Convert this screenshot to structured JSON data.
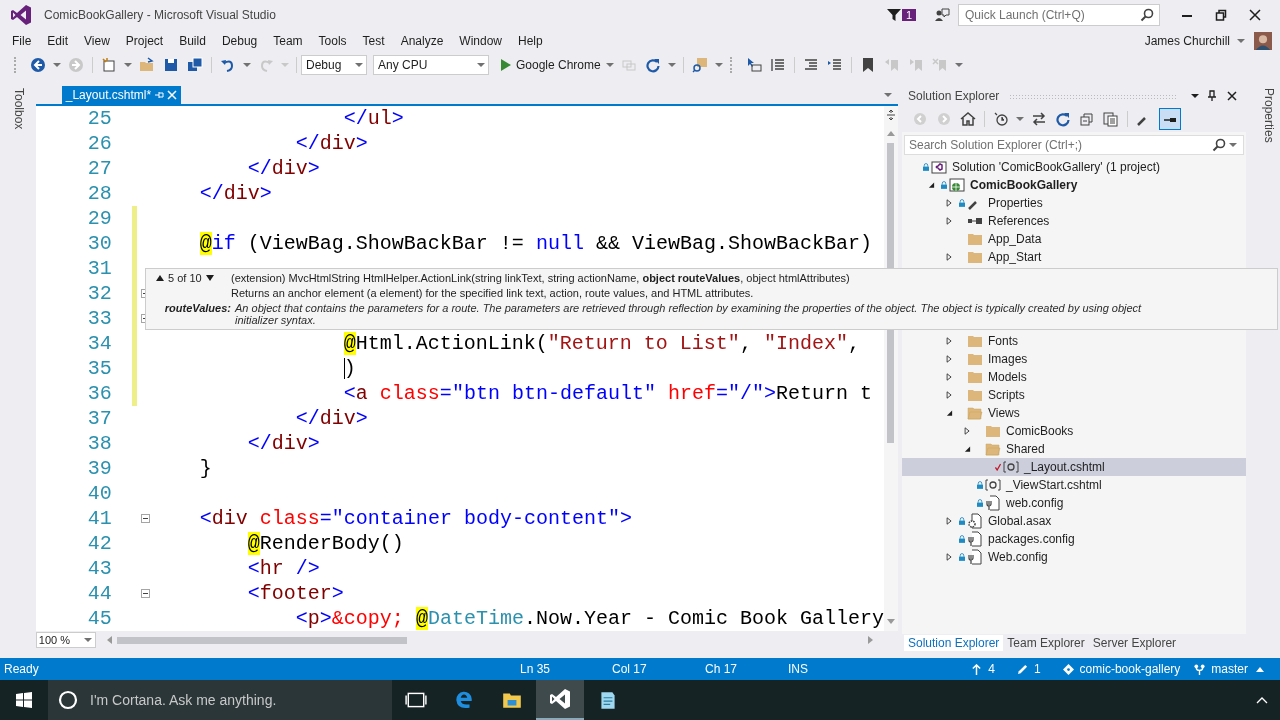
{
  "window": {
    "title": "ComicBookGallery - Microsoft Visual Studio",
    "notification_count": "1",
    "quick_launch": {
      "placeholder": "Quick Launch (Ctrl+Q)"
    }
  },
  "menu": [
    "File",
    "Edit",
    "View",
    "Project",
    "Build",
    "Debug",
    "Team",
    "Tools",
    "Test",
    "Analyze",
    "Window",
    "Help"
  ],
  "user": {
    "name": "James Churchill"
  },
  "toolbar": {
    "configuration": "Debug",
    "platform": "Any CPU",
    "start": "Google Chrome"
  },
  "side_tabs": {
    "left": "Toolbox",
    "right": "Properties"
  },
  "editor": {
    "tab": {
      "label": "_Layout.cshtml*",
      "selected": true
    },
    "zoom": "100 %",
    "lines": [
      {
        "num": "25",
        "tokens": [
          {
            "text": "                </",
            "kind": "delimiter"
          },
          {
            "text": "ul",
            "kind": "tag"
          },
          {
            "text": ">",
            "kind": "delimiter"
          }
        ]
      },
      {
        "num": "26",
        "tokens": [
          {
            "text": "            </",
            "kind": "delimiter"
          },
          {
            "text": "div",
            "kind": "tag"
          },
          {
            "text": ">",
            "kind": "delimiter"
          }
        ]
      },
      {
        "num": "27",
        "tokens": [
          {
            "text": "        </",
            "kind": "delimiter"
          },
          {
            "text": "div",
            "kind": "tag"
          },
          {
            "text": ">",
            "kind": "delimiter"
          }
        ]
      },
      {
        "num": "28",
        "tokens": [
          {
            "text": "    </",
            "kind": "delimiter"
          },
          {
            "text": "div",
            "kind": "tag"
          },
          {
            "text": ">",
            "kind": "delimiter"
          }
        ]
      },
      {
        "num": "29",
        "changed": true
      },
      {
        "num": "30",
        "changed": true,
        "tokens": [
          {
            "text": "    @",
            "kind": "razor"
          },
          {
            "text": "if",
            "kind": "keyword"
          },
          {
            "text": " (ViewBag.ShowBackBar != ",
            "kind": "plain"
          },
          {
            "text": "null",
            "kind": "keyword"
          },
          {
            "text": " && ViewBag.ShowBackBar)",
            "kind": "plain"
          }
        ]
      },
      {
        "num": "31",
        "changed": true
      },
      {
        "num": "32",
        "changed": true,
        "folding": true
      },
      {
        "num": "33",
        "changed": true,
        "folding": true
      },
      {
        "num": "34",
        "changed": true,
        "tokens": [
          {
            "text": "                @",
            "kind": "razor"
          },
          {
            "text": "Html.ActionLink(",
            "kind": "plain"
          },
          {
            "text": "\"Return to List\"",
            "kind": "string"
          },
          {
            "text": ", ",
            "kind": "plain"
          },
          {
            "text": "\"Index\"",
            "kind": "string"
          },
          {
            "text": ",",
            "kind": "plain"
          }
        ]
      },
      {
        "num": "35",
        "changed": true,
        "caret": true,
        "tokens": [
          {
            "text": "                )",
            "kind": "plain"
          }
        ]
      },
      {
        "num": "36",
        "changed": true,
        "tokens": [
          {
            "text": "                <",
            "kind": "delimiter"
          },
          {
            "text": "a",
            "kind": "tag"
          },
          {
            "text": " class",
            "kind": "attribute"
          },
          {
            "text": "=",
            "kind": "delimiter"
          },
          {
            "text": "\"btn btn-default\"",
            "kind": "value"
          },
          {
            "text": " href",
            "kind": "attribute"
          },
          {
            "text": "=",
            "kind": "delimiter"
          },
          {
            "text": "\"/\"",
            "kind": "value"
          },
          {
            "text": ">",
            "kind": "delimiter"
          },
          {
            "text": "Return t",
            "kind": "plain"
          }
        ]
      },
      {
        "num": "37",
        "tokens": [
          {
            "text": "            </",
            "kind": "delimiter"
          },
          {
            "text": "div",
            "kind": "tag"
          },
          {
            "text": ">",
            "kind": "delimiter"
          }
        ]
      },
      {
        "num": "38",
        "tokens": [
          {
            "text": "        </",
            "kind": "delimiter"
          },
          {
            "text": "div",
            "kind": "tag"
          },
          {
            "text": ">",
            "kind": "delimiter"
          }
        ]
      },
      {
        "num": "39",
        "tokens": [
          {
            "text": "    }",
            "kind": "plain"
          }
        ]
      },
      {
        "num": "40"
      },
      {
        "num": "41",
        "folding": true,
        "tokens": [
          {
            "text": "    <",
            "kind": "delimiter"
          },
          {
            "text": "div",
            "kind": "tag"
          },
          {
            "text": " class",
            "kind": "attribute"
          },
          {
            "text": "=",
            "kind": "delimiter"
          },
          {
            "text": "\"container body-content\"",
            "kind": "value"
          },
          {
            "text": ">",
            "kind": "delimiter"
          }
        ]
      },
      {
        "num": "42",
        "tokens": [
          {
            "text": "        @",
            "kind": "razor"
          },
          {
            "text": "RenderBody()",
            "kind": "plain"
          }
        ]
      },
      {
        "num": "43",
        "tokens": [
          {
            "text": "        <",
            "kind": "delimiter"
          },
          {
            "text": "hr",
            "kind": "tag"
          },
          {
            "text": " />",
            "kind": "delimiter"
          }
        ]
      },
      {
        "num": "44",
        "folding": true,
        "tokens": [
          {
            "text": "        <",
            "kind": "delimiter"
          },
          {
            "text": "footer",
            "kind": "tag"
          },
          {
            "text": ">",
            "kind": "delimiter"
          }
        ]
      },
      {
        "num": "45",
        "tokens": [
          {
            "text": "            <",
            "kind": "delimiter"
          },
          {
            "text": "p",
            "kind": "tag"
          },
          {
            "text": ">",
            "kind": "delimiter"
          },
          {
            "text": "&copy;",
            "kind": "entity"
          },
          {
            "text": " @",
            "kind": "razor"
          },
          {
            "text": "DateTime",
            "kind": "type"
          },
          {
            "text": ".Now.Year - Comic Book Gallery",
            "kind": "plain"
          }
        ]
      }
    ]
  },
  "tooltip": {
    "counter": "5 of 10",
    "signature": "(extension) MvcHtmlString HtmlHelper.ActionLink(string linkText, string actionName, **object routeValues**, object htmlAttributes)",
    "summary": "Returns an anchor element (a element) for the specified link text, action, route values, and HTML attributes.",
    "param_name": "routeValues:",
    "param_description": "An object that contains the parameters for a route. The parameters are retrieved through reflection by examining the properties of the object. The object is typically created by using object initializer syntax."
  },
  "solution_explorer": {
    "title": "Solution Explorer",
    "search": {
      "placeholder": "Search Solution Explorer (Ctrl+;)"
    },
    "tree": [
      {
        "label": "Solution 'ComicBookGallery' (1 project)",
        "kind": "solution",
        "locked": true,
        "selected": false,
        "children": [
          {
            "label": "ComicBookGallery",
            "kind": "project",
            "locked": true,
            "selected": false,
            "expanded": true,
            "children": [
              {
                "label": "Properties",
                "kind": "properties",
                "locked": true,
                "selected": false,
                "expanded": false
              },
              {
                "label": "References",
                "kind": "references",
                "selected": false,
                "expanded": false
              },
              {
                "label": "App_Data",
                "kind": "folder",
                "selected": false
              },
              {
                "label": "App_Start",
                "kind": "folder",
                "selected": false,
                "expanded": false
              },
              {
                "label": "Fonts",
                "kind": "folder",
                "selected": false,
                "expanded": false
              },
              {
                "label": "Images",
                "kind": "folder",
                "selected": false,
                "expanded": false
              },
              {
                "label": "Models",
                "kind": "folder",
                "selected": false,
                "expanded": false
              },
              {
                "label": "Scripts",
                "kind": "folder",
                "selected": false,
                "expanded": false
              },
              {
                "label": "Views",
                "kind": "folder",
                "selected": false,
                "expanded": true,
                "children": [
                  {
                    "label": "ComicBooks",
                    "kind": "folder",
                    "selected": false,
                    "expanded": false
                  },
                  {
                    "label": "Shared",
                    "kind": "folder",
                    "selected": false,
                    "expanded": true,
                    "children": [
                      {
                        "label": "_Layout.cshtml",
                        "kind": "razor",
                        "checked_out": true,
                        "selected": true
                      }
                    ]
                  },
                  {
                    "label": "_ViewStart.cshtml",
                    "kind": "razor",
                    "locked": true,
                    "selected": false
                  },
                  {
                    "label": "web.config",
                    "kind": "config",
                    "locked": true,
                    "selected": false
                  }
                ]
              },
              {
                "label": "Global.asax",
                "kind": "asax",
                "locked": true,
                "selected": false,
                "expanded": false
              },
              {
                "label": "packages.config",
                "kind": "config",
                "locked": true,
                "selected": false
              },
              {
                "label": "Web.config",
                "kind": "config",
                "locked": true,
                "selected": false,
                "expanded": false
              }
            ]
          }
        ]
      }
    ],
    "tabs": [
      {
        "label": "Solution Explorer",
        "selected": true
      },
      {
        "label": "Team Explorer",
        "selected": false
      },
      {
        "label": "Server Explorer",
        "selected": false
      }
    ]
  },
  "status_bar": {
    "state": "Ready",
    "line": "Ln 35",
    "column": "Col 17",
    "char": "Ch 17",
    "mode": "INS",
    "unpushed": "4",
    "changes": "1",
    "repository": "comic-book-gallery",
    "branch": "master"
  },
  "taskbar": {
    "search": {
      "placeholder": "I'm Cortana. Ask me anything."
    },
    "apps": [
      {
        "kind": "task-view",
        "selected": false
      },
      {
        "kind": "edge",
        "selected": false
      },
      {
        "kind": "explorer",
        "selected": false
      },
      {
        "kind": "visual-studio",
        "selected": true
      },
      {
        "kind": "notepad",
        "selected": false
      }
    ]
  }
}
